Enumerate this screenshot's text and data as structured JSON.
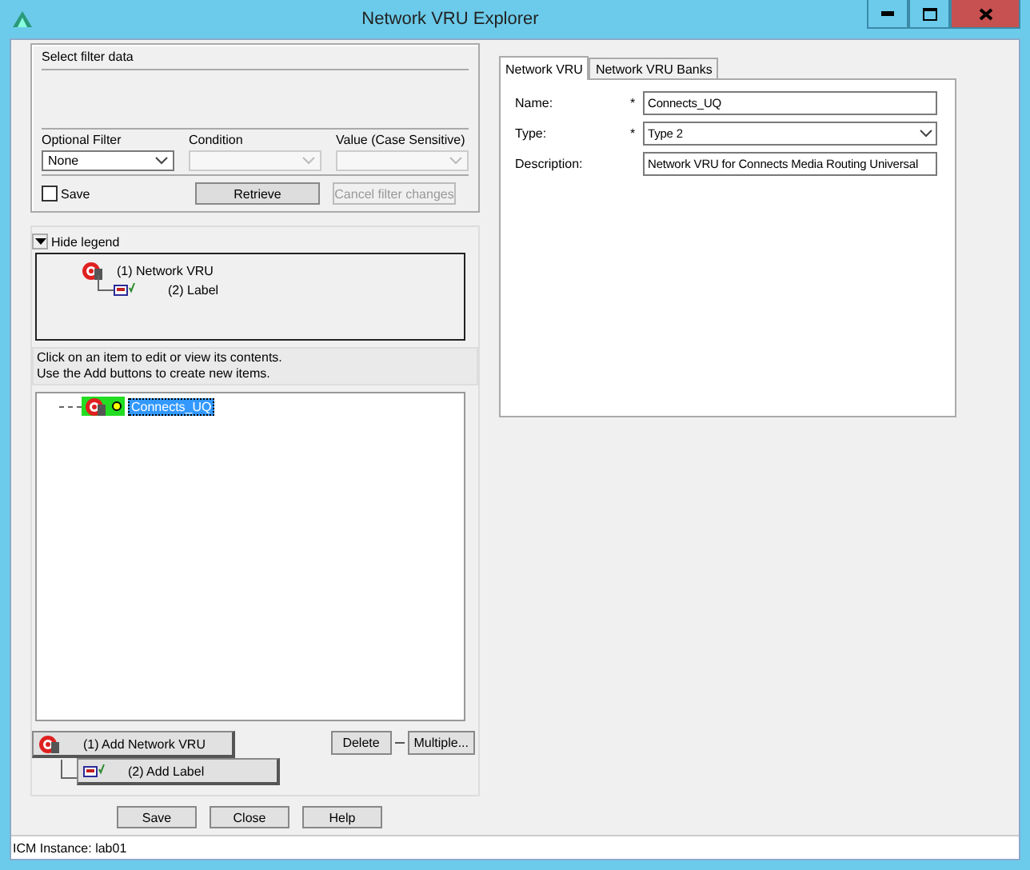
{
  "window": {
    "title": "Network VRU Explorer"
  },
  "filter": {
    "title": "Select filter data",
    "fields": [
      {
        "label": "Optional Filter",
        "value": "None",
        "disabled": false
      },
      {
        "label": "Condition",
        "disabled": true
      },
      {
        "label": "Value (Case Sensitive)",
        "disabled": true
      }
    ],
    "save": {
      "label": "Save",
      "checked": false
    },
    "retrieve": "Retrieve",
    "cancel": {
      "label": "Cancel filter changes",
      "disabled": true
    }
  },
  "legend": {
    "toggle": "Hide legend",
    "items": [
      {
        "label": "(1) Network VRU",
        "kind": "vru"
      },
      {
        "label": "(2) Label",
        "kind": "label"
      }
    ]
  },
  "hint": [
    "Click on an item to edit or view its contents.",
    "Use the Add buttons to create new items."
  ],
  "tree": [
    {
      "label": "Connects_UQ",
      "kind": "vru",
      "selected": true
    }
  ],
  "add_buttons": [
    {
      "label": "(1) Add Network VRU",
      "kind": "vru"
    },
    {
      "label": "(2) Add Label",
      "kind": "label"
    }
  ],
  "actions": [
    "Delete",
    "Multiple..."
  ],
  "tabs": [
    {
      "label": "Network VRU",
      "selected": true
    },
    {
      "label": "Network VRU Banks",
      "selected": false
    }
  ],
  "form": [
    {
      "label": "Name:",
      "marker": "*",
      "kind": "text",
      "value": "Connects_UQ"
    },
    {
      "label": "Type:",
      "marker": "*",
      "kind": "select",
      "value": "Type 2"
    },
    {
      "label": "Description:",
      "kind": "text",
      "value": "Network VRU for Connects Media Routing Universal"
    }
  ],
  "footer_buttons": [
    "Save",
    "Close",
    "Help"
  ],
  "status_bar": "ICM Instance: lab01"
}
